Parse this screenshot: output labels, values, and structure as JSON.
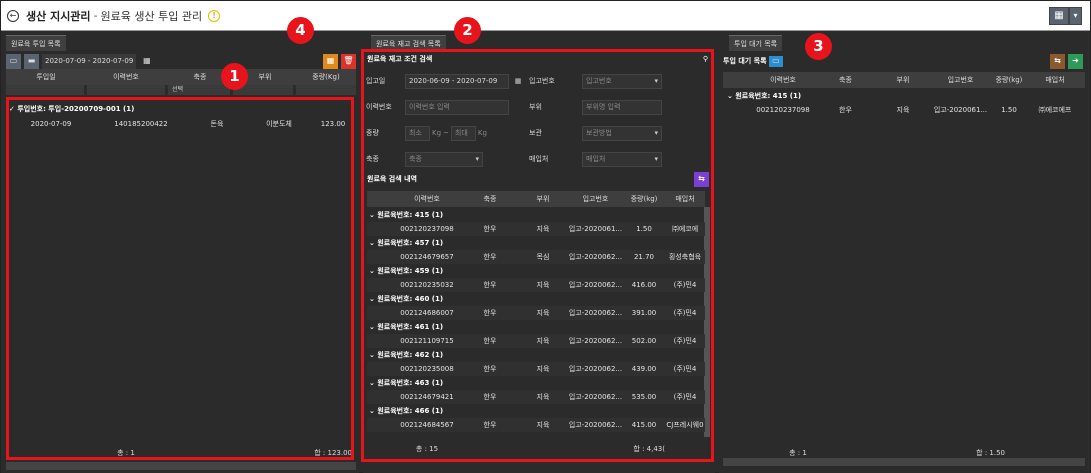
{
  "title": {
    "main": "생산 지시관리",
    "sep": "-",
    "sub": "원료육 생산 투입 관리"
  },
  "badges": [
    "1",
    "2",
    "3",
    "4"
  ],
  "left": {
    "tab": "원료육 투입 목록",
    "date": "2020-07-09 - 2020-07-09",
    "columns": [
      "투입일",
      "이력번호",
      "축종",
      "부위",
      "중량(Kg)"
    ],
    "filter_select": "선택",
    "group": "투입번호: 투입-20200709-001 (1)",
    "rows": [
      [
        "2020-07-09",
        "140185200422",
        "돈육",
        "이분도체",
        "123.00"
      ]
    ],
    "footer_count": "총 : 1",
    "footer_sum": "합 : 123.00"
  },
  "middle": {
    "tab": "원료육 재고 검색 목록",
    "search_title": "원료육 재고 조건 검색",
    "form": {
      "date_label": "입고일",
      "date_value": "2020-06-09 - 2020-07-09",
      "inno_label": "입고번호",
      "inno_ph": "입고번호",
      "trace_label": "이력번호",
      "trace_ph": "이력번호 입력",
      "part_label": "부위",
      "part_ph": "부위명 입력",
      "weight_label": "중량",
      "weight_min": "최소",
      "weight_kg": "Kg",
      "weight_tilde": "~",
      "weight_max": "최대",
      "weight_kg2": "Kg",
      "storage_label": "보관",
      "storage_ph": "보관방법",
      "species_label": "축종",
      "species_ph": "축종",
      "buyer_label": "매입처",
      "buyer_ph": "매입처"
    },
    "result_title": "원료육 검색 내역",
    "columns": [
      "이력번호",
      "축종",
      "부위",
      "입고번호",
      "중량(kg)",
      "매입처"
    ],
    "groups": [
      {
        "label": "원료육번호: 415 (1)",
        "row": [
          "002120237098",
          "한우",
          "지육",
          "입고-2020061...",
          "1.50",
          "㈜에코에"
        ]
      },
      {
        "label": "원료육번호: 457 (1)",
        "row": [
          "002124679657",
          "한우",
          "목심",
          "입고-2020062...",
          "21.70",
          "횡성축협육"
        ]
      },
      {
        "label": "원료육번호: 459 (1)",
        "row": [
          "002120235032",
          "한우",
          "지육",
          "입고-2020062...",
          "416.00",
          "(주)민4"
        ]
      },
      {
        "label": "원료육번호: 460 (1)",
        "row": [
          "002124686007",
          "한우",
          "지육",
          "입고-2020062...",
          "391.00",
          "(주)민4"
        ]
      },
      {
        "label": "원료육번호: 461 (1)",
        "row": [
          "002121109715",
          "한우",
          "지육",
          "입고-2020062...",
          "502.00",
          "(주)민4"
        ]
      },
      {
        "label": "원료육번호: 462 (1)",
        "row": [
          "002120235008",
          "한우",
          "지육",
          "입고-2020062...",
          "439.00",
          "(주)민4"
        ]
      },
      {
        "label": "원료육번호: 463 (1)",
        "row": [
          "002124679421",
          "한우",
          "지육",
          "입고-2020062...",
          "535.00",
          "(주)민4"
        ]
      },
      {
        "label": "원료육번호: 466 (1)",
        "row": [
          "002124684567",
          "한우",
          "지육",
          "입고-2020062...",
          "415.00",
          "CJ프레시웨0"
        ]
      }
    ],
    "footer_count": "총 : 15",
    "footer_sum": "합 : 4,43("
  },
  "right": {
    "tab": "투입 대기 목록",
    "columns": [
      "이력번호",
      "축종",
      "부위",
      "입고번호",
      "중량(kg)",
      "매입처"
    ],
    "group": "원료육번호: 415 (1)",
    "row": [
      "002120237098",
      "한우",
      "지육",
      "입고-2020061...",
      "1.50",
      "㈜에코에프"
    ],
    "footer_count": "총 : 1",
    "footer_sum": "합 : 1.50"
  }
}
